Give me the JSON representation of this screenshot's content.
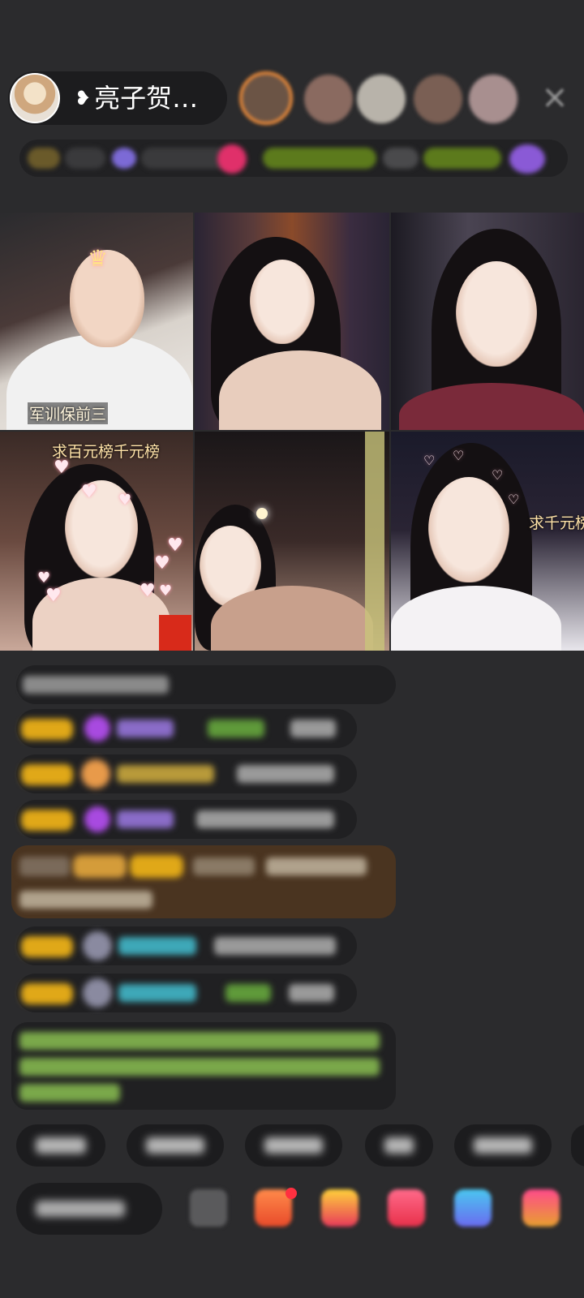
{
  "host": {
    "name": "亮子贺…",
    "heart": "❥"
  },
  "close_icon": "×",
  "grid": {
    "cells": [
      {
        "label": "军训保前三"
      },
      {
        "label": ""
      },
      {
        "label": ""
      },
      {
        "label": "求百元榜千元榜"
      },
      {
        "label": ""
      },
      {
        "label": "求千元榜"
      }
    ]
  },
  "colors": {
    "background": "#2b2b2d",
    "pill": "#1c1c1e",
    "badge_gold": "#e0a818",
    "chat_green": "#8fd14f",
    "chat_cyan": "#4ec3d6",
    "chat_purple": "#b06cf0",
    "highlight_brown": "#5a3f1e"
  }
}
